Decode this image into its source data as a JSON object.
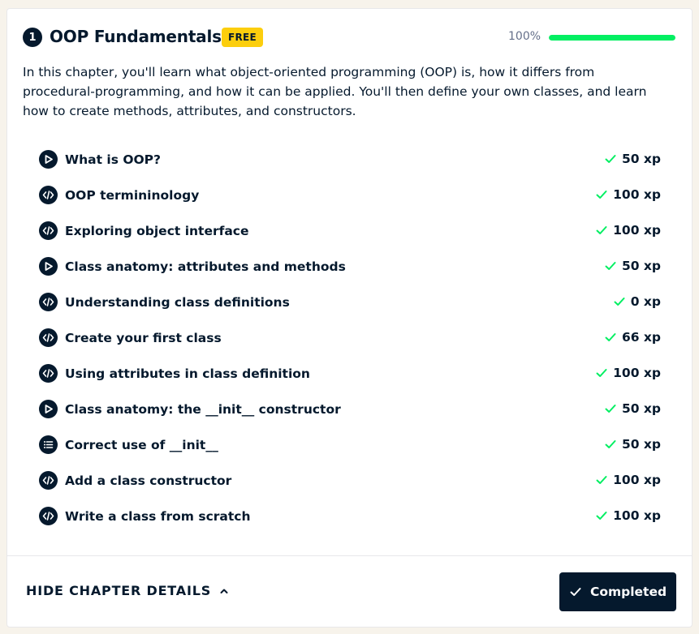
{
  "chapter": {
    "number": "1",
    "title": "OOP Fundamentals",
    "badge": "FREE",
    "progress_text": "100%",
    "progress_value": 1.0,
    "description": "In this chapter, you'll learn what object-oriented programming (OOP) is, how it differs from procedural-programming, and how it can be applied. You'll then define your own classes, and learn how to create methods, attributes, and constructors."
  },
  "lessons": [
    {
      "title": "What is OOP?",
      "xp": "50 xp",
      "icon": "play-icon"
    },
    {
      "title": "OOP termininology",
      "xp": "100 xp",
      "icon": "code-icon"
    },
    {
      "title": "Exploring object interface",
      "xp": "100 xp",
      "icon": "code-icon"
    },
    {
      "title": "Class anatomy: attributes and methods",
      "xp": "50 xp",
      "icon": "play-icon"
    },
    {
      "title": "Understanding class definitions",
      "xp": "0 xp",
      "icon": "code-icon"
    },
    {
      "title": "Create your first class",
      "xp": "66 xp",
      "icon": "code-icon"
    },
    {
      "title": "Using attributes in class definition",
      "xp": "100 xp",
      "icon": "code-icon"
    },
    {
      "title": "Class anatomy: the __init__ constructor",
      "xp": "50 xp",
      "icon": "play-icon"
    },
    {
      "title": "Correct use of __init__",
      "xp": "50 xp",
      "icon": "list-icon"
    },
    {
      "title": "Add a class constructor",
      "xp": "100 xp",
      "icon": "code-icon"
    },
    {
      "title": "Write a class from scratch",
      "xp": "100 xp",
      "icon": "code-icon"
    }
  ],
  "footer": {
    "toggle_label": "HIDE CHAPTER DETAILS",
    "completed_label": "Completed"
  },
  "colors": {
    "navy": "#05192d",
    "green": "#03ef62",
    "badge_yellow": "#fcce0d",
    "background": "#f7f3eb"
  }
}
